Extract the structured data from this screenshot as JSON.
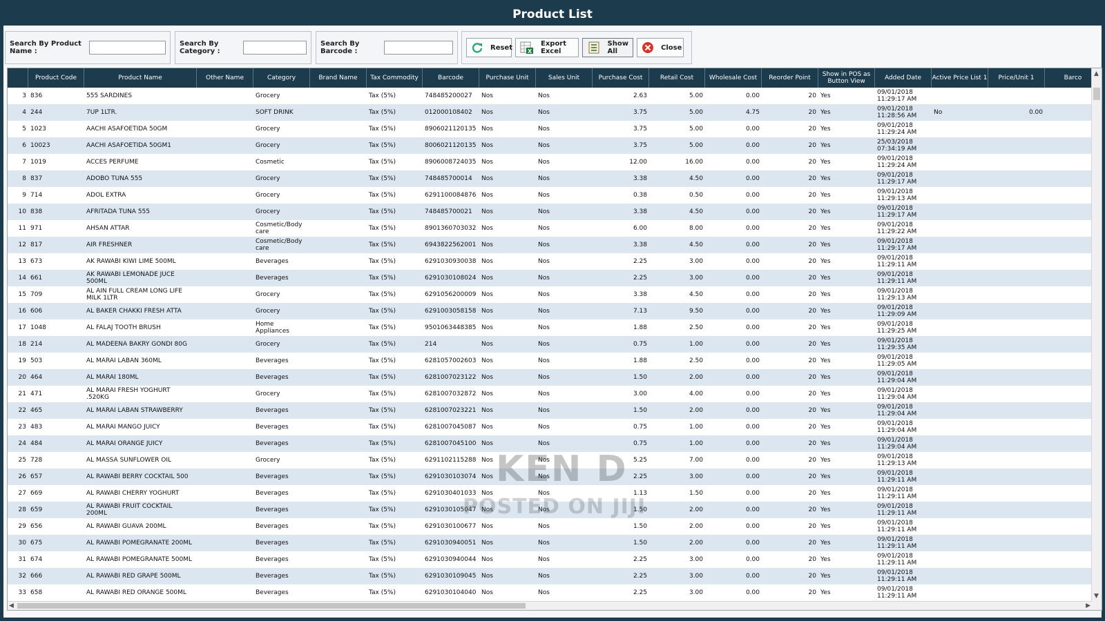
{
  "window": {
    "title": "Product List"
  },
  "search": {
    "product_name_label": "Search By Product Name :",
    "product_name_value": "",
    "category_label": "Search By Category :",
    "category_value": "",
    "barcode_label": "Search By Barcode :",
    "barcode_value": ""
  },
  "buttons": {
    "reset": "Reset",
    "export_excel": "Export Excel",
    "show_all": "Show All",
    "close": "Close"
  },
  "colors": {
    "header_bg": "#1c3b4d",
    "row_alt": "#dbe6f1",
    "reset_icon": "#2aa876",
    "close_icon": "#d9342b",
    "excel_icon": "#1f7a3e"
  },
  "icons": {
    "reset": "refresh-icon",
    "export_excel": "excel-icon",
    "show_all": "list-icon",
    "close": "close-circle-icon"
  },
  "table": {
    "columns": [
      "",
      "Product Code",
      "Product Name",
      "Other Name",
      "Category",
      "Brand Name",
      "Tax Commodity",
      "Barcode",
      "Purchase Unit",
      "Sales Unit",
      "Purchase Cost",
      "Retail Cost",
      "Wholesale Cost",
      "Reorder Point",
      "Show in POS as Button View",
      "Added Date",
      "Active Price List 1",
      "Price/Unit 1",
      "Barco"
    ],
    "rows": [
      [
        "3",
        "836",
        "555 SARDINES",
        "",
        "Grocery",
        "",
        "Tax (5%)",
        "748485200027",
        "Nos",
        "Nos",
        "2.63",
        "5.00",
        "0.00",
        "20",
        "Yes",
        "09/01/2018 11:29:17 AM",
        "",
        ""
      ],
      [
        "4",
        "244",
        "7UP 1LTR.",
        "",
        "SOFT DRINK",
        "",
        "Tax (5%)",
        "012000108402",
        "Nos",
        "Nos",
        "3.75",
        "5.00",
        "4.75",
        "20",
        "Yes",
        "09/01/2018 11:28:56 AM",
        "No",
        "0.00"
      ],
      [
        "5",
        "1023",
        "AACHI ASAFOETIDA  50GM",
        "",
        "Grocery",
        "",
        "Tax (5%)",
        "8906021120135",
        "Nos",
        "Nos",
        "3.75",
        "5.00",
        "0.00",
        "20",
        "Yes",
        "09/01/2018 11:29:24 AM",
        "",
        ""
      ],
      [
        "6",
        "10023",
        "AACHI ASAFOETIDA  50GM1",
        "",
        "Grocery",
        "",
        "Tax (5%)",
        "8006021120135",
        "Nos",
        "Nos",
        "3.75",
        "5.00",
        "0.00",
        "20",
        "Yes",
        "25/03/2018 07:34:19 AM",
        "",
        ""
      ],
      [
        "7",
        "1019",
        "ACCES PERFUME",
        "",
        "Cosmetic",
        "",
        "Tax (5%)",
        "8906008724035",
        "Nos",
        "Nos",
        "12.00",
        "16.00",
        "0.00",
        "20",
        "Yes",
        "09/01/2018 11:29:24 AM",
        "",
        ""
      ],
      [
        "8",
        "837",
        "ADOBO TUNA 555",
        "",
        "Grocery",
        "",
        "Tax (5%)",
        "748485700014",
        "Nos",
        "Nos",
        "3.38",
        "4.50",
        "0.00",
        "20",
        "Yes",
        "09/01/2018 11:29:17 AM",
        "",
        ""
      ],
      [
        "9",
        "714",
        "ADOL EXTRA",
        "",
        "Grocery",
        "",
        "Tax (5%)",
        "6291100084876",
        "Nos",
        "Nos",
        "0.38",
        "0.50",
        "0.00",
        "20",
        "Yes",
        "09/01/2018 11:29:13 AM",
        "",
        ""
      ],
      [
        "10",
        "838",
        "AFRITADA TUNA 555",
        "",
        "Grocery",
        "",
        "Tax (5%)",
        "748485700021",
        "Nos",
        "Nos",
        "3.38",
        "4.50",
        "0.00",
        "20",
        "Yes",
        "09/01/2018 11:29:17 AM",
        "",
        ""
      ],
      [
        "11",
        "971",
        "AHSAN ATTAR",
        "",
        "Cosmetic/Body care",
        "",
        "Tax (5%)",
        "8901360703032",
        "Nos",
        "Nos",
        "6.00",
        "8.00",
        "0.00",
        "20",
        "Yes",
        "09/01/2018 11:29:22 AM",
        "",
        ""
      ],
      [
        "12",
        "817",
        "AIR FRESHNER",
        "",
        "Cosmetic/Body care",
        "",
        "Tax (5%)",
        "6943822562001",
        "Nos",
        "Nos",
        "3.38",
        "4.50",
        "0.00",
        "20",
        "Yes",
        "09/01/2018 11:29:17 AM",
        "",
        ""
      ],
      [
        "13",
        "673",
        "AK RAWABI KIWI LIME 500ML",
        "",
        "Beverages",
        "",
        "Tax (5%)",
        "6291030930038",
        "Nos",
        "Nos",
        "2.25",
        "3.00",
        "0.00",
        "20",
        "Yes",
        "09/01/2018 11:29:11 AM",
        "",
        ""
      ],
      [
        "14",
        "661",
        "AK RAWABI LEMONADE JUCE 500ML",
        "",
        "Beverages",
        "",
        "Tax (5%)",
        "6291030108024",
        "Nos",
        "Nos",
        "2.25",
        "3.00",
        "0.00",
        "20",
        "Yes",
        "09/01/2018 11:29:11 AM",
        "",
        ""
      ],
      [
        "15",
        "709",
        "AL AIN FULL CREAM LONG LIFE  MILK 1LTR",
        "",
        "Grocery",
        "",
        "Tax (5%)",
        "6291056200009",
        "Nos",
        "Nos",
        "3.38",
        "4.50",
        "0.00",
        "20",
        "Yes",
        "09/01/2018 11:29:13 AM",
        "",
        ""
      ],
      [
        "16",
        "606",
        "AL BAKER CHAKKI FRESH ATTA",
        "",
        "Grocery",
        "",
        "Tax (5%)",
        "6291003058158",
        "Nos",
        "Nos",
        "7.13",
        "9.50",
        "0.00",
        "20",
        "Yes",
        "09/01/2018 11:29:09 AM",
        "",
        ""
      ],
      [
        "17",
        "1048",
        "AL FALAJ TOOTH BRUSH",
        "",
        "Home Appliances",
        "",
        "Tax (5%)",
        "9501063448385",
        "Nos",
        "Nos",
        "1.88",
        "2.50",
        "0.00",
        "20",
        "Yes",
        "09/01/2018 11:29:25 AM",
        "",
        ""
      ],
      [
        "18",
        "214",
        "AL MADEENA BAKRY GONDI 80G",
        "",
        "Grocery",
        "",
        "Tax (5%)",
        "214",
        "Nos",
        "Nos",
        "0.75",
        "1.00",
        "0.00",
        "20",
        "Yes",
        "09/01/2018 11:29:35 AM",
        "",
        ""
      ],
      [
        "19",
        "503",
        "AL MARAI  LABAN  360ML",
        "",
        "Beverages",
        "",
        "Tax (5%)",
        "6281057002603",
        "Nos",
        "Nos",
        "1.88",
        "2.50",
        "0.00",
        "20",
        "Yes",
        "09/01/2018 11:29:05 AM",
        "",
        ""
      ],
      [
        "20",
        "464",
        "AL MARAI 180ML",
        "",
        "Beverages",
        "",
        "Tax (5%)",
        "6281007023122",
        "Nos",
        "Nos",
        "1.50",
        "2.00",
        "0.00",
        "20",
        "Yes",
        "09/01/2018 11:29:04 AM",
        "",
        ""
      ],
      [
        "21",
        "471",
        "AL MARAI FRESH YOGHURT .520KG",
        "",
        "Grocery",
        "",
        "Tax (5%)",
        "6281007032872",
        "Nos",
        "Nos",
        "3.00",
        "4.00",
        "0.00",
        "20",
        "Yes",
        "09/01/2018 11:29:04 AM",
        "",
        ""
      ],
      [
        "22",
        "465",
        "AL MARAI LABAN STRAWBERRY",
        "",
        "Beverages",
        "",
        "Tax (5%)",
        "6281007023221",
        "Nos",
        "Nos",
        "1.50",
        "2.00",
        "0.00",
        "20",
        "Yes",
        "09/01/2018 11:29:04 AM",
        "",
        ""
      ],
      [
        "23",
        "483",
        "AL MARAI MANGO JUICY",
        "",
        "Beverages",
        "",
        "Tax (5%)",
        "6281007045087",
        "Nos",
        "Nos",
        "0.75",
        "1.00",
        "0.00",
        "20",
        "Yes",
        "09/01/2018 11:29:04 AM",
        "",
        ""
      ],
      [
        "24",
        "484",
        "AL MARAI ORANGE  JUICY",
        "",
        "Beverages",
        "",
        "Tax (5%)",
        "6281007045100",
        "Nos",
        "Nos",
        "0.75",
        "1.00",
        "0.00",
        "20",
        "Yes",
        "09/01/2018 11:29:04 AM",
        "",
        ""
      ],
      [
        "25",
        "728",
        "AL MASSA SUNFLOWER OIL",
        "",
        "Grocery",
        "",
        "Tax (5%)",
        "6291102115288",
        "Nos",
        "Nos",
        "5.25",
        "7.00",
        "0.00",
        "20",
        "Yes",
        "09/01/2018 11:29:13 AM",
        "",
        ""
      ],
      [
        "26",
        "657",
        "AL RAWABI BERRY COCKTAIL 500",
        "",
        "Beverages",
        "",
        "Tax (5%)",
        "6291030103074",
        "Nos",
        "Nos",
        "2.25",
        "3.00",
        "0.00",
        "20",
        "Yes",
        "09/01/2018 11:29:11 AM",
        "",
        ""
      ],
      [
        "27",
        "669",
        "AL RAWABI CHERRY YOGHURT",
        "",
        "Beverages",
        "",
        "Tax (5%)",
        "6291030401033",
        "Nos",
        "Nos",
        "1.13",
        "1.50",
        "0.00",
        "20",
        "Yes",
        "09/01/2018 11:29:11 AM",
        "",
        ""
      ],
      [
        "28",
        "659",
        "AL RAWABI FRUIT COCKTAIL 200ML",
        "",
        "Beverages",
        "",
        "Tax (5%)",
        "6291030105047",
        "Nos",
        "Nos",
        "1.50",
        "2.00",
        "0.00",
        "20",
        "Yes",
        "09/01/2018 11:29:11 AM",
        "",
        ""
      ],
      [
        "29",
        "656",
        "AL RAWABI GUAVA 200ML",
        "",
        "Beverages",
        "",
        "Tax (5%)",
        "6291030100677",
        "Nos",
        "Nos",
        "1.50",
        "2.00",
        "0.00",
        "20",
        "Yes",
        "09/01/2018 11:29:11 AM",
        "",
        ""
      ],
      [
        "30",
        "675",
        "AL RAWABI POMEGRANATE 200ML",
        "",
        "Beverages",
        "",
        "Tax (5%)",
        "6291030940051",
        "Nos",
        "Nos",
        "1.50",
        "2.00",
        "0.00",
        "20",
        "Yes",
        "09/01/2018 11:29:11 AM",
        "",
        ""
      ],
      [
        "31",
        "674",
        "AL RAWABI POMEGRANATE 500ML",
        "",
        "Beverages",
        "",
        "Tax (5%)",
        "6291030940044",
        "Nos",
        "Nos",
        "2.25",
        "3.00",
        "0.00",
        "20",
        "Yes",
        "09/01/2018 11:29:11 AM",
        "",
        ""
      ],
      [
        "32",
        "666",
        "AL RAWABI RED GRAPE 500ML",
        "",
        "Beverages",
        "",
        "Tax (5%)",
        "6291030109045",
        "Nos",
        "Nos",
        "2.25",
        "3.00",
        "0.00",
        "20",
        "Yes",
        "09/01/2018 11:29:11 AM",
        "",
        ""
      ],
      [
        "33",
        "658",
        "AL RAWABI RED ORANGE 500ML",
        "",
        "Beverages",
        "",
        "Tax (5%)",
        "6291030104040",
        "Nos",
        "Nos",
        "2.25",
        "3.00",
        "0.00",
        "20",
        "Yes",
        "09/01/2018 11:29:11 AM",
        "",
        ""
      ]
    ]
  },
  "watermark": {
    "line1": "KEN D",
    "line2": "POSTED ON JIJI"
  }
}
